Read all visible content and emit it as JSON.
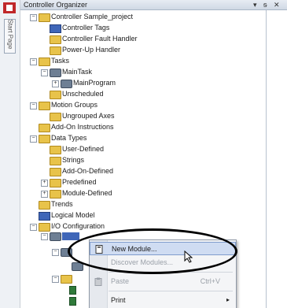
{
  "window": {
    "title": "Controller Organizer",
    "controls": [
      "▾",
      "ᵴ",
      "✕"
    ]
  },
  "dock": {
    "tab_label": "Start Page"
  },
  "tree": {
    "items": [
      {
        "label": "Controller Sample_project"
      },
      {
        "label": "Controller Tags"
      },
      {
        "label": "Controller Fault Handler"
      },
      {
        "label": "Power-Up Handler"
      },
      {
        "label": "Tasks"
      },
      {
        "label": "MainTask"
      },
      {
        "label": "MainProgram"
      },
      {
        "label": "Unscheduled"
      },
      {
        "label": "Motion Groups"
      },
      {
        "label": "Ungrouped Axes"
      },
      {
        "label": "Add-On Instructions"
      },
      {
        "label": "Data Types"
      },
      {
        "label": "User-Defined"
      },
      {
        "label": "Strings"
      },
      {
        "label": "Add-On-Defined"
      },
      {
        "label": "Predefined"
      },
      {
        "label": "Module-Defined"
      },
      {
        "label": "Trends"
      },
      {
        "label": "Logical Model"
      },
      {
        "label": "I/O Configuration"
      }
    ]
  },
  "context_menu": {
    "items": [
      {
        "label": "New Module...",
        "state": "highlighted"
      },
      {
        "label": "Discover Modules...",
        "state": "disabled"
      },
      {
        "label": "Paste",
        "shortcut": "Ctrl+V",
        "state": "disabled"
      },
      {
        "label": "Print",
        "submenu": "▸"
      }
    ]
  },
  "colors": {
    "highlight": "#cfdcf2",
    "folder": "#e8c34a",
    "selection": "#3f66b8"
  }
}
